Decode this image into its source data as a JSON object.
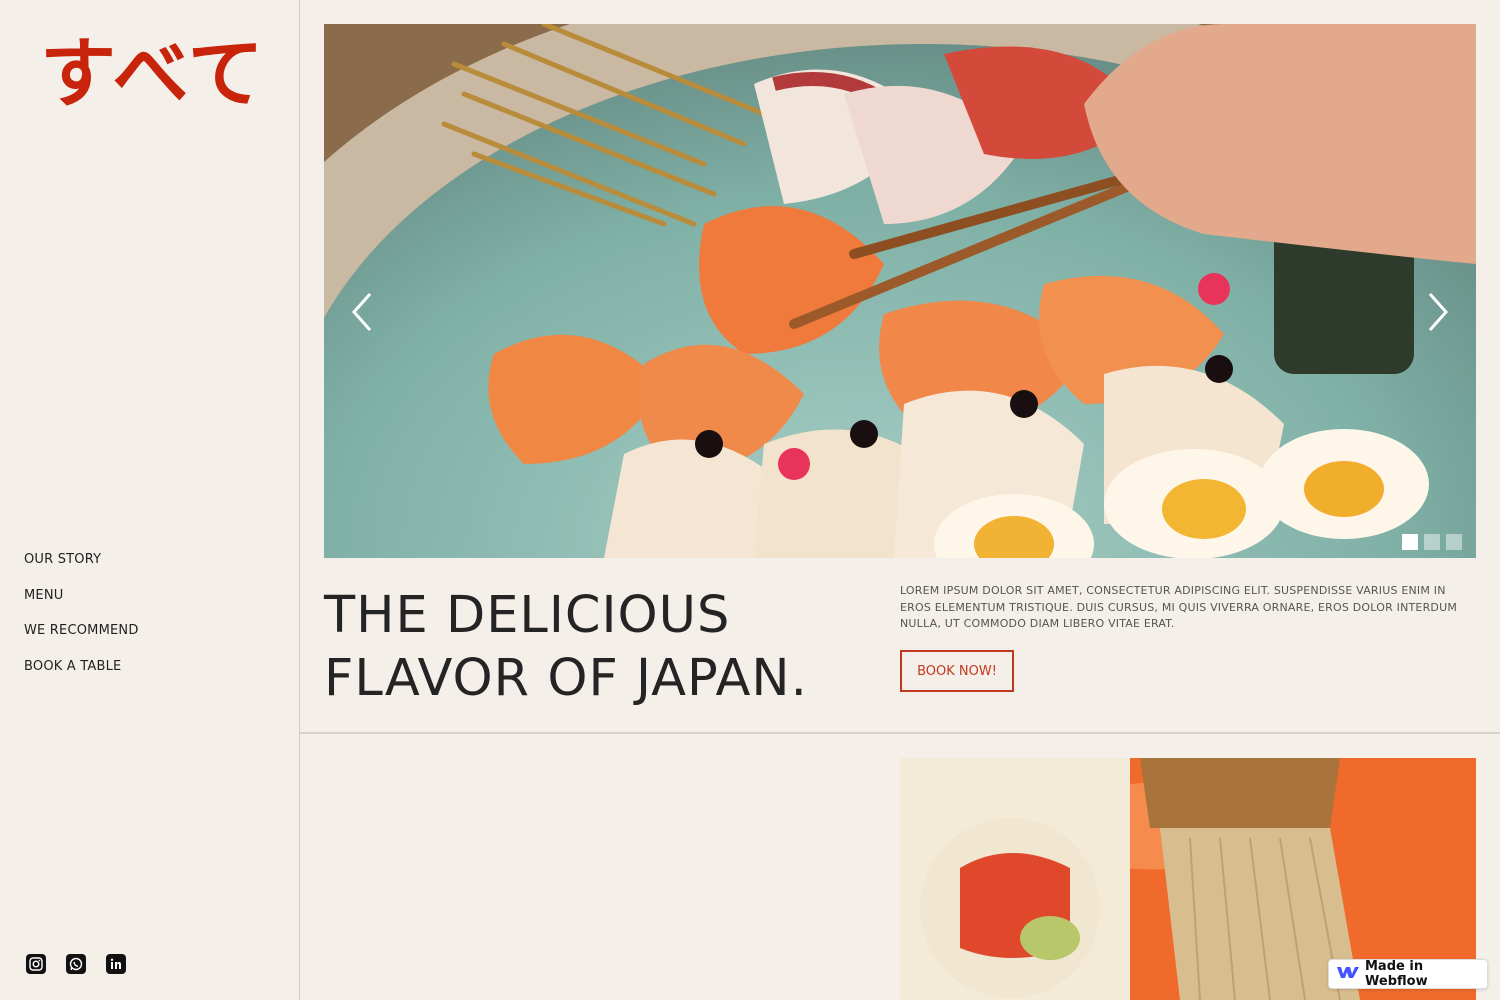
{
  "brand": {
    "logo_text": "すべて",
    "accent_color": "#c8230b"
  },
  "nav": {
    "items": [
      "OUR STORY",
      "MENU",
      "WE RECOMMEND",
      "BOOK A TABLE"
    ]
  },
  "social": [
    "instagram-icon",
    "whatsapp-icon",
    "linkedin-icon"
  ],
  "hero": {
    "slides": 3,
    "active_slide": 1
  },
  "intro": {
    "headline_line1": "THE DELICIOUS",
    "headline_line2": "FLAVOR OF JAPAN.",
    "description": "LOREM IPSUM DOLOR SIT AMET, CONSECTETUR ADIPISCING ELIT. SUSPENDISSE VARIUS ENIM IN EROS ELEMENTUM TRISTIQUE. DUIS CURSUS, MI QUIS VIVERRA ORNARE, EROS DOLOR INTERDUM NULLA, UT COMMODO DIAM LIBERO VITAE ERAT.",
    "cta_label": "BOOK NOW!"
  },
  "badge": {
    "label": "Made in Webflow"
  }
}
